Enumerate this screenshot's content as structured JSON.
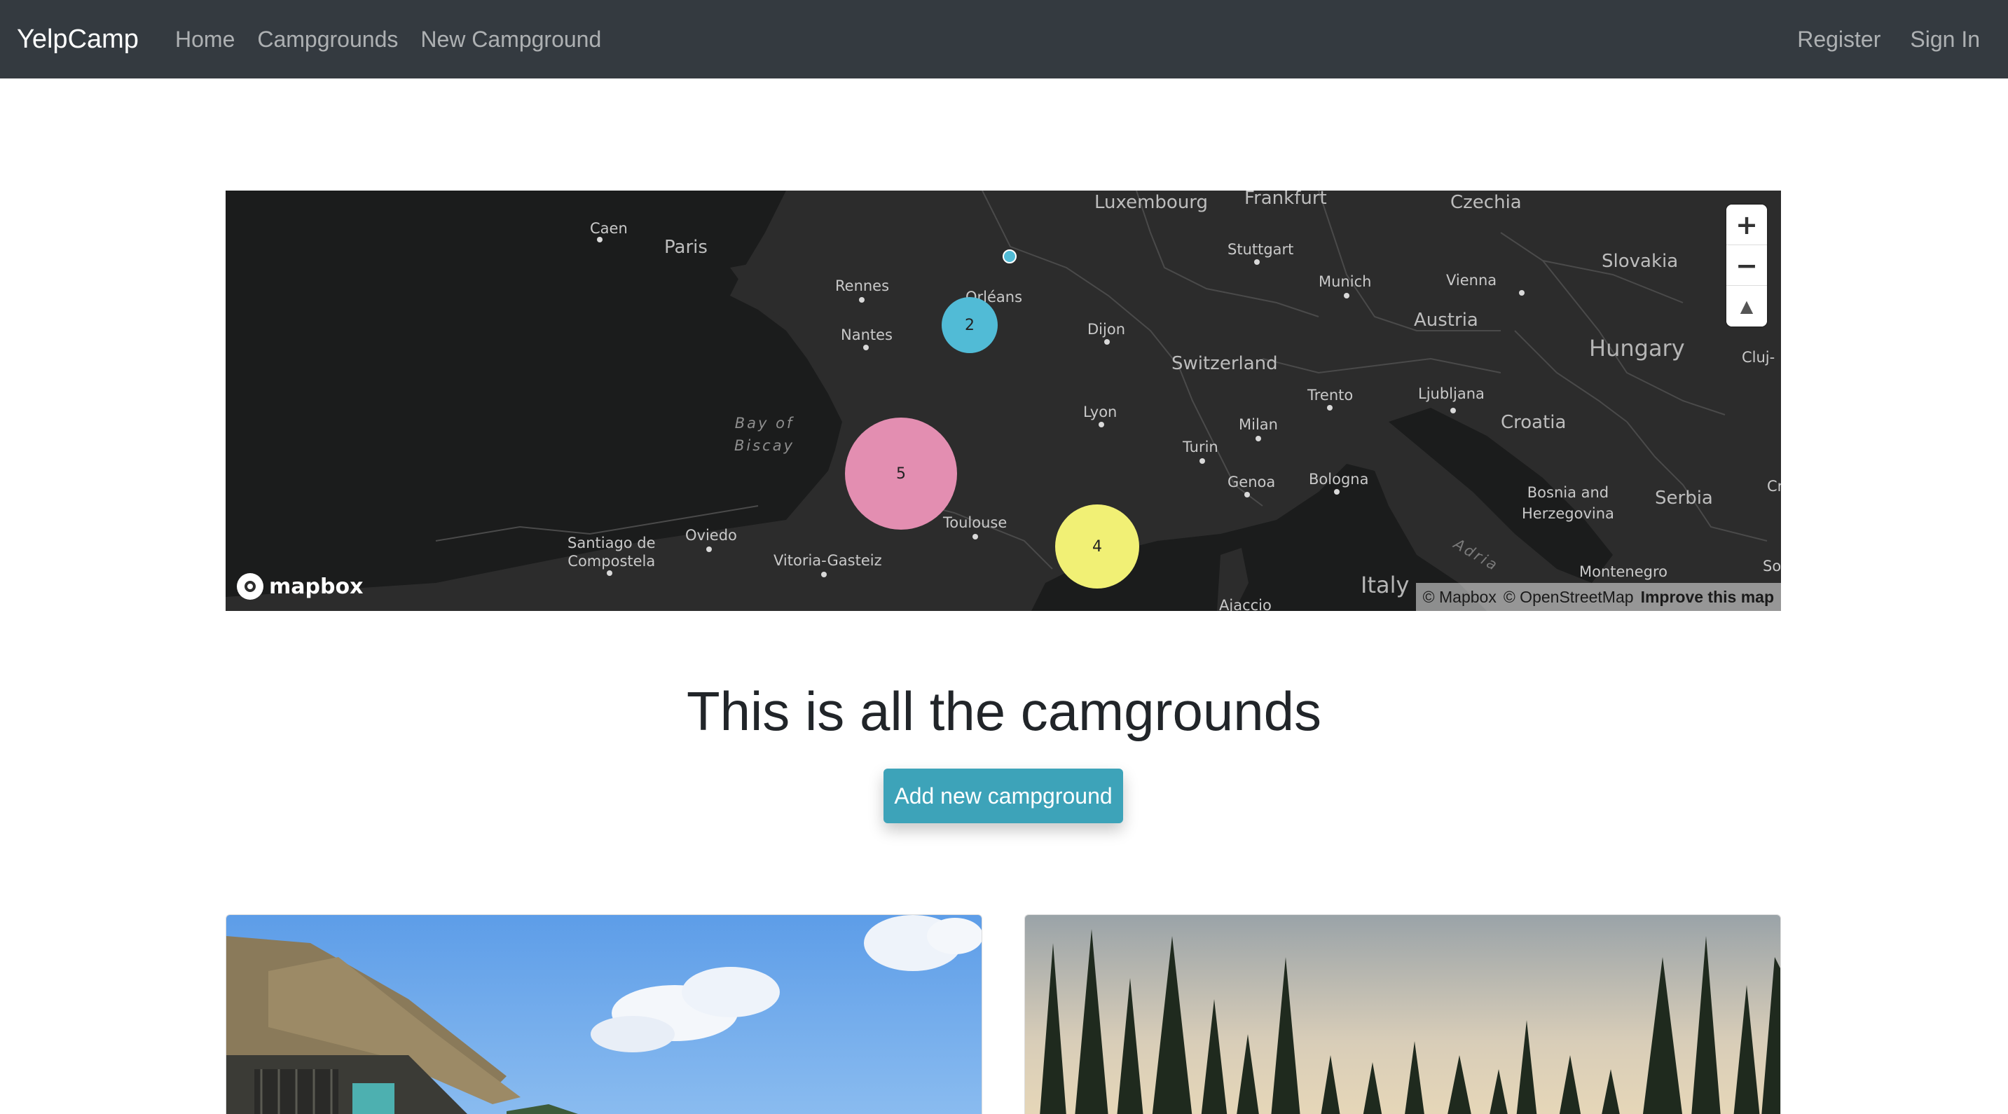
{
  "navbar": {
    "brand": "YelpCamp",
    "links": [
      "Home",
      "Campgrounds",
      "New Campground"
    ],
    "right_links": [
      "Register",
      "Sign In"
    ]
  },
  "map": {
    "labels": {
      "caen": "Caen",
      "paris": "Paris",
      "luxembourg": "Luxembourg",
      "frankfurt": "Frankfurt",
      "czechia": "Czechia",
      "stuttgart": "Stuttgart",
      "rennes": "Rennes",
      "orleans": "Orléans",
      "munich": "Munich",
      "vienna": "Vienna",
      "slovakia": "Slovakia",
      "nantes": "Nantes",
      "dijon": "Dijon",
      "austria": "Austria",
      "switzerland": "Switzerland",
      "hungary": "Hungary",
      "cluj": "Cluj-",
      "lyon": "Lyon",
      "trento": "Trento",
      "ljubljana": "Ljubljana",
      "bay_of_biscay": "Bay of\nBiscay",
      "milan": "Milan",
      "croatia": "Croatia",
      "turin": "Turin",
      "genoa": "Genoa",
      "bologna": "Bologna",
      "bosnia": "Bosnia and\nHerzegovina",
      "serbia": "Serbia",
      "cr": "Cr",
      "toulouse": "Toulouse",
      "santiago": "Santiago de\nCompostela",
      "oviedo": "Oviedo",
      "vitoria": "Vitoria-Gasteiz",
      "adria": "Adria",
      "montenegro": "Montenegro",
      "sof": "Sof",
      "italy": "Italy",
      "ajaccio": "Ajaccio"
    },
    "clusters": [
      {
        "count": "2",
        "color": "#51bbd6"
      },
      {
        "count": "5",
        "color": "#e38eb1"
      },
      {
        "count": "4",
        "color": "#f1f075"
      }
    ],
    "zoom_in": "+",
    "zoom_out": "−",
    "compass": "▲",
    "logo_text": "mapbox",
    "attribution": {
      "mapbox": "© Mapbox",
      "osm": "© OpenStreetMap",
      "improve": "Improve this map"
    }
  },
  "main": {
    "heading": "This is all the camgrounds",
    "add_button": "Add new campground"
  },
  "colors": {
    "navbar": "#343a40",
    "button": "#3da3b9",
    "map_land": "#2c2c2c",
    "map_water": "#1b1c1c"
  }
}
